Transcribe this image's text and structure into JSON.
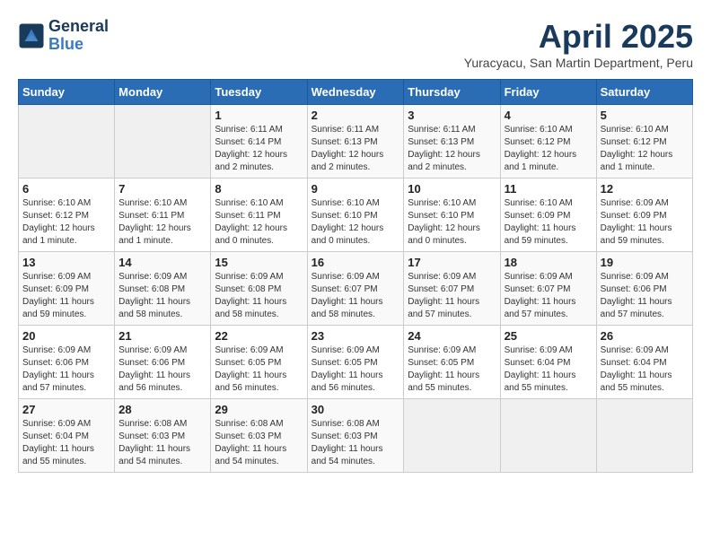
{
  "logo": {
    "line1": "General",
    "line2": "Blue"
  },
  "title": "April 2025",
  "subtitle": "Yuracyacu, San Martin Department, Peru",
  "days_of_week": [
    "Sunday",
    "Monday",
    "Tuesday",
    "Wednesday",
    "Thursday",
    "Friday",
    "Saturday"
  ],
  "weeks": [
    [
      {
        "day": "",
        "info": ""
      },
      {
        "day": "",
        "info": ""
      },
      {
        "day": "1",
        "info": "Sunrise: 6:11 AM\nSunset: 6:14 PM\nDaylight: 12 hours\nand 2 minutes."
      },
      {
        "day": "2",
        "info": "Sunrise: 6:11 AM\nSunset: 6:13 PM\nDaylight: 12 hours\nand 2 minutes."
      },
      {
        "day": "3",
        "info": "Sunrise: 6:11 AM\nSunset: 6:13 PM\nDaylight: 12 hours\nand 2 minutes."
      },
      {
        "day": "4",
        "info": "Sunrise: 6:10 AM\nSunset: 6:12 PM\nDaylight: 12 hours\nand 1 minute."
      },
      {
        "day": "5",
        "info": "Sunrise: 6:10 AM\nSunset: 6:12 PM\nDaylight: 12 hours\nand 1 minute."
      }
    ],
    [
      {
        "day": "6",
        "info": "Sunrise: 6:10 AM\nSunset: 6:12 PM\nDaylight: 12 hours\nand 1 minute."
      },
      {
        "day": "7",
        "info": "Sunrise: 6:10 AM\nSunset: 6:11 PM\nDaylight: 12 hours\nand 1 minute."
      },
      {
        "day": "8",
        "info": "Sunrise: 6:10 AM\nSunset: 6:11 PM\nDaylight: 12 hours\nand 0 minutes."
      },
      {
        "day": "9",
        "info": "Sunrise: 6:10 AM\nSunset: 6:10 PM\nDaylight: 12 hours\nand 0 minutes."
      },
      {
        "day": "10",
        "info": "Sunrise: 6:10 AM\nSunset: 6:10 PM\nDaylight: 12 hours\nand 0 minutes."
      },
      {
        "day": "11",
        "info": "Sunrise: 6:10 AM\nSunset: 6:09 PM\nDaylight: 11 hours\nand 59 minutes."
      },
      {
        "day": "12",
        "info": "Sunrise: 6:09 AM\nSunset: 6:09 PM\nDaylight: 11 hours\nand 59 minutes."
      }
    ],
    [
      {
        "day": "13",
        "info": "Sunrise: 6:09 AM\nSunset: 6:09 PM\nDaylight: 11 hours\nand 59 minutes."
      },
      {
        "day": "14",
        "info": "Sunrise: 6:09 AM\nSunset: 6:08 PM\nDaylight: 11 hours\nand 58 minutes."
      },
      {
        "day": "15",
        "info": "Sunrise: 6:09 AM\nSunset: 6:08 PM\nDaylight: 11 hours\nand 58 minutes."
      },
      {
        "day": "16",
        "info": "Sunrise: 6:09 AM\nSunset: 6:07 PM\nDaylight: 11 hours\nand 58 minutes."
      },
      {
        "day": "17",
        "info": "Sunrise: 6:09 AM\nSunset: 6:07 PM\nDaylight: 11 hours\nand 57 minutes."
      },
      {
        "day": "18",
        "info": "Sunrise: 6:09 AM\nSunset: 6:07 PM\nDaylight: 11 hours\nand 57 minutes."
      },
      {
        "day": "19",
        "info": "Sunrise: 6:09 AM\nSunset: 6:06 PM\nDaylight: 11 hours\nand 57 minutes."
      }
    ],
    [
      {
        "day": "20",
        "info": "Sunrise: 6:09 AM\nSunset: 6:06 PM\nDaylight: 11 hours\nand 57 minutes."
      },
      {
        "day": "21",
        "info": "Sunrise: 6:09 AM\nSunset: 6:06 PM\nDaylight: 11 hours\nand 56 minutes."
      },
      {
        "day": "22",
        "info": "Sunrise: 6:09 AM\nSunset: 6:05 PM\nDaylight: 11 hours\nand 56 minutes."
      },
      {
        "day": "23",
        "info": "Sunrise: 6:09 AM\nSunset: 6:05 PM\nDaylight: 11 hours\nand 56 minutes."
      },
      {
        "day": "24",
        "info": "Sunrise: 6:09 AM\nSunset: 6:05 PM\nDaylight: 11 hours\nand 55 minutes."
      },
      {
        "day": "25",
        "info": "Sunrise: 6:09 AM\nSunset: 6:04 PM\nDaylight: 11 hours\nand 55 minutes."
      },
      {
        "day": "26",
        "info": "Sunrise: 6:09 AM\nSunset: 6:04 PM\nDaylight: 11 hours\nand 55 minutes."
      }
    ],
    [
      {
        "day": "27",
        "info": "Sunrise: 6:09 AM\nSunset: 6:04 PM\nDaylight: 11 hours\nand 55 minutes."
      },
      {
        "day": "28",
        "info": "Sunrise: 6:08 AM\nSunset: 6:03 PM\nDaylight: 11 hours\nand 54 minutes."
      },
      {
        "day": "29",
        "info": "Sunrise: 6:08 AM\nSunset: 6:03 PM\nDaylight: 11 hours\nand 54 minutes."
      },
      {
        "day": "30",
        "info": "Sunrise: 6:08 AM\nSunset: 6:03 PM\nDaylight: 11 hours\nand 54 minutes."
      },
      {
        "day": "",
        "info": ""
      },
      {
        "day": "",
        "info": ""
      },
      {
        "day": "",
        "info": ""
      }
    ]
  ]
}
